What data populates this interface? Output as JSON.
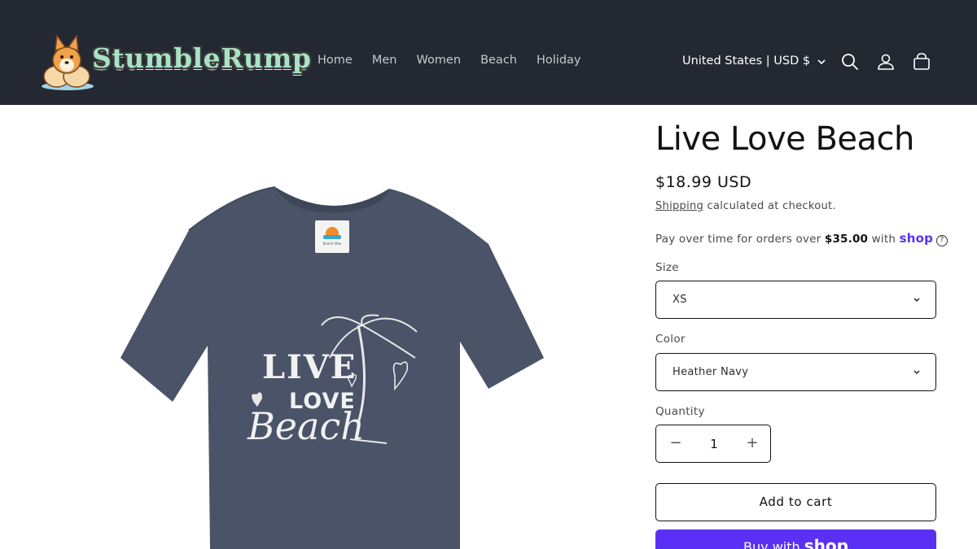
{
  "header": {
    "brand": "StumbleRump",
    "nav": [
      "Home",
      "Men",
      "Women",
      "Beach",
      "Holiday"
    ],
    "locale": "United States | USD $",
    "icons": [
      "search-icon",
      "account-icon",
      "cart-icon"
    ]
  },
  "product": {
    "title": "Live Love Beach",
    "price": "$18.99 USD",
    "shipping_link": "Shipping",
    "shipping_text": " calculated at checkout.",
    "installments": {
      "prefix": "Pay over time for orders over ",
      "amount": "$35.00",
      "suffix": " with ",
      "provider": "shop"
    },
    "image": {
      "tag_text": "Beach Vibe",
      "print_line1": "LIVE",
      "print_line2": "LOVE",
      "print_line3": "Beach"
    },
    "size": {
      "label": "Size",
      "selected": "XS"
    },
    "color": {
      "label": "Color",
      "selected": "Heather Navy"
    },
    "quantity": {
      "label": "Quantity",
      "value": "1"
    },
    "add_to_cart": "Add to cart",
    "buy_with_prefix": "Buy with ",
    "buy_with_brand": "shop"
  },
  "colors": {
    "header_bg": "#242833",
    "shirt": "#4a5368",
    "shop_purple": "#5a31f4"
  }
}
